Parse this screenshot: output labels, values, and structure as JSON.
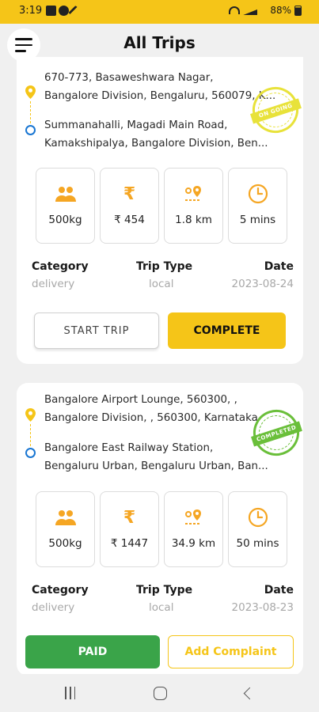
{
  "status_bar": {
    "time": "3:19",
    "battery": "88%"
  },
  "header": {
    "title": "All Trips"
  },
  "trips": [
    {
      "pickup_lines": [
        "670-773, Basaweshwara Nagar,",
        "Bangalore Division, Bengaluru, 560079, K..."
      ],
      "drop_lines": [
        "Summanahalli, Magadi Main Road,",
        "Kamakshipalya, Bangalore Division, Ben..."
      ],
      "stamp": "ON GOING",
      "weight": "500kg",
      "fare": "₹ 454",
      "distance": "1.8 km",
      "duration": "5 mins",
      "category_label": "Category",
      "category": "delivery",
      "trip_type_label": "Trip Type",
      "trip_type": "local",
      "date_label": "Date",
      "date": "2023-08-24",
      "primary_action": "START TRIP",
      "secondary_action": "COMPLETE"
    },
    {
      "pickup_lines": [
        "Bangalore Airport Lounge, 560300, ,",
        "Bangalore Division, , 560300, Karnataka"
      ],
      "drop_lines": [
        "Bangalore East Railway Station,",
        "Bengaluru Urban, Bengaluru Urban, Ban..."
      ],
      "stamp": "COMPLETED",
      "weight": "500kg",
      "fare": "₹ 1447",
      "distance": "34.9 km",
      "duration": "50 mins",
      "category_label": "Category",
      "category": "delivery",
      "trip_type_label": "Trip Type",
      "trip_type": "local",
      "date_label": "Date",
      "date": "2023-08-23",
      "primary_action": "PAID",
      "secondary_action": "Add Complaint"
    }
  ],
  "colors": {
    "accent": "#f5c518",
    "paid": "#3aa449",
    "completed_stamp": "#6abf3a",
    "ongoing_stamp": "#e8e23a",
    "destination": "#1976d2"
  },
  "icons": {
    "weight": "people-icon",
    "fare": "rupee-icon",
    "distance": "route-pin-icon",
    "duration": "clock-icon"
  }
}
